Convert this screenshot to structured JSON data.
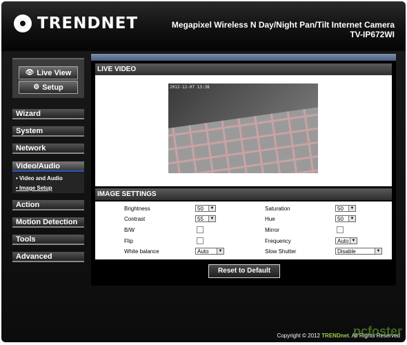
{
  "header": {
    "brand": "TRENDNET",
    "title": "Megapixel Wireless N Day/Night Pan/Tilt Internet Camera",
    "model": "TV-IP672WI"
  },
  "sidebar": {
    "live_view": "Live View",
    "setup": "Setup",
    "nav": [
      "Wizard",
      "System",
      "Network",
      "Video/Audio",
      "Action",
      "Motion Detection",
      "Tools",
      "Advanced"
    ],
    "active": "Video/Audio",
    "submenu": [
      "Video and Audio",
      "Image Setup"
    ],
    "current_sub": "Image Setup"
  },
  "live_video": {
    "heading": "LIVE VIDEO",
    "overlay": "2012-12-07 13:38"
  },
  "image_settings": {
    "heading": "IMAGE SETTINGS",
    "brightness": {
      "label": "Brightness",
      "value": "50"
    },
    "contrast": {
      "label": "Contrast",
      "value": "55"
    },
    "bw": {
      "label": "B/W",
      "checked": false
    },
    "flip": {
      "label": "Flip",
      "checked": false
    },
    "white_balance": {
      "label": "White balance",
      "value": "Auto"
    },
    "saturation": {
      "label": "Saturation",
      "value": "50"
    },
    "hue": {
      "label": "Hue",
      "value": "50"
    },
    "mirror": {
      "label": "Mirror",
      "checked": false
    },
    "frequency": {
      "label": "Frequency",
      "value": "Auto"
    },
    "slow_shutter": {
      "label": "Slow Shutter",
      "value": "Disable"
    }
  },
  "reset_button": "Reset to Default",
  "footer": {
    "prefix": "Copyright © 2012 ",
    "brand": "TRENDnet",
    "suffix": ". All Rights Reserved"
  },
  "watermark": "pcfoster"
}
